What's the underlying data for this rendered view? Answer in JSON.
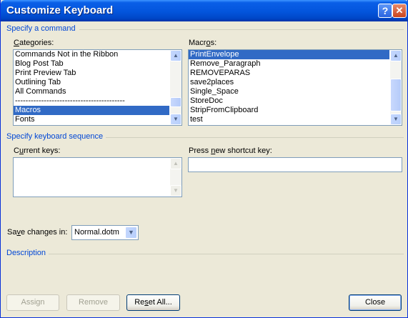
{
  "window": {
    "title": "Customize Keyboard",
    "help_glyph": "?",
    "close_glyph": "✕"
  },
  "groups": {
    "command": "Specify a command",
    "keyboard": "Specify keyboard sequence",
    "description": "Description"
  },
  "categories": {
    "label_pre": "",
    "label_key": "C",
    "label_post": "ategories:",
    "items": [
      "Commands Not in the Ribbon",
      "Blog Post Tab",
      "Print Preview Tab",
      "Outlining Tab",
      "All Commands",
      "------------------------------------------",
      "Macros",
      "Fonts"
    ],
    "selected_index": 6
  },
  "macros": {
    "label_pre": "Macr",
    "label_key": "o",
    "label_post": "s:",
    "items": [
      "PrintEnvelope",
      "Remove_Paragraph",
      "REMOVEPARAS",
      "save2places",
      "Single_Space",
      "StoreDoc",
      "StripFromClipboard",
      "test"
    ],
    "selected_index": 0
  },
  "current_keys": {
    "label_pre": "C",
    "label_key": "u",
    "label_post": "rrent keys:"
  },
  "new_shortcut": {
    "label_pre": "Press ",
    "label_key": "n",
    "label_post": "ew shortcut key:",
    "value": ""
  },
  "save_changes": {
    "label_pre": "Sa",
    "label_key": "v",
    "label_post": "e changes in:",
    "value": "Normal.dotm"
  },
  "buttons": {
    "assign": "Assign",
    "remove": "Remove",
    "reset_pre": "Re",
    "reset_key": "s",
    "reset_post": "et All...",
    "close": "Close"
  },
  "icons": {
    "scroll_up": "▲",
    "scroll_down": "▼"
  },
  "colors": {
    "titlebar": "#0355dc",
    "group_label": "#0046d5",
    "selection": "#316ac5"
  }
}
